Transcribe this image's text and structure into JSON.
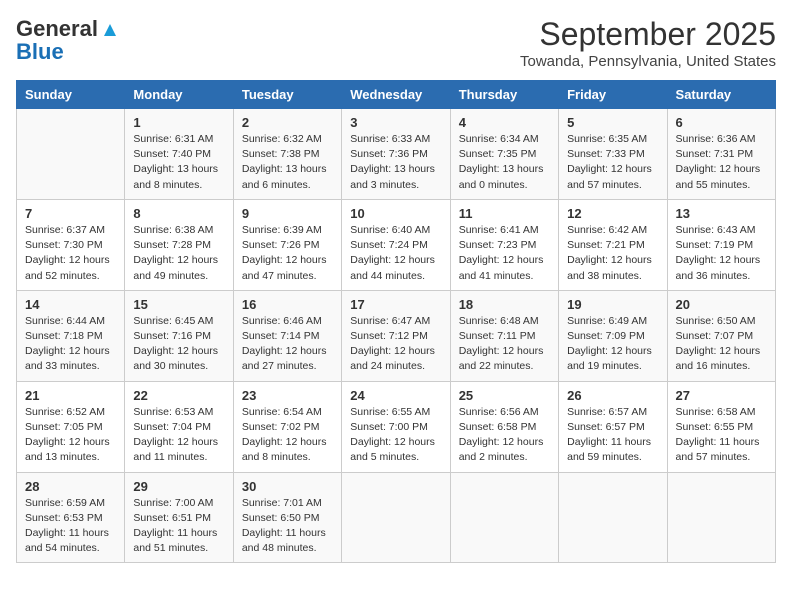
{
  "header": {
    "logo_general": "General",
    "logo_blue": "Blue",
    "month_title": "September 2025",
    "location": "Towanda, Pennsylvania, United States"
  },
  "days_of_week": [
    "Sunday",
    "Monday",
    "Tuesday",
    "Wednesday",
    "Thursday",
    "Friday",
    "Saturday"
  ],
  "weeks": [
    [
      {
        "day": "",
        "sunrise": "",
        "sunset": "",
        "daylight": ""
      },
      {
        "day": "1",
        "sunrise": "Sunrise: 6:31 AM",
        "sunset": "Sunset: 7:40 PM",
        "daylight": "Daylight: 13 hours and 8 minutes."
      },
      {
        "day": "2",
        "sunrise": "Sunrise: 6:32 AM",
        "sunset": "Sunset: 7:38 PM",
        "daylight": "Daylight: 13 hours and 6 minutes."
      },
      {
        "day": "3",
        "sunrise": "Sunrise: 6:33 AM",
        "sunset": "Sunset: 7:36 PM",
        "daylight": "Daylight: 13 hours and 3 minutes."
      },
      {
        "day": "4",
        "sunrise": "Sunrise: 6:34 AM",
        "sunset": "Sunset: 7:35 PM",
        "daylight": "Daylight: 13 hours and 0 minutes."
      },
      {
        "day": "5",
        "sunrise": "Sunrise: 6:35 AM",
        "sunset": "Sunset: 7:33 PM",
        "daylight": "Daylight: 12 hours and 57 minutes."
      },
      {
        "day": "6",
        "sunrise": "Sunrise: 6:36 AM",
        "sunset": "Sunset: 7:31 PM",
        "daylight": "Daylight: 12 hours and 55 minutes."
      }
    ],
    [
      {
        "day": "7",
        "sunrise": "Sunrise: 6:37 AM",
        "sunset": "Sunset: 7:30 PM",
        "daylight": "Daylight: 12 hours and 52 minutes."
      },
      {
        "day": "8",
        "sunrise": "Sunrise: 6:38 AM",
        "sunset": "Sunset: 7:28 PM",
        "daylight": "Daylight: 12 hours and 49 minutes."
      },
      {
        "day": "9",
        "sunrise": "Sunrise: 6:39 AM",
        "sunset": "Sunset: 7:26 PM",
        "daylight": "Daylight: 12 hours and 47 minutes."
      },
      {
        "day": "10",
        "sunrise": "Sunrise: 6:40 AM",
        "sunset": "Sunset: 7:24 PM",
        "daylight": "Daylight: 12 hours and 44 minutes."
      },
      {
        "day": "11",
        "sunrise": "Sunrise: 6:41 AM",
        "sunset": "Sunset: 7:23 PM",
        "daylight": "Daylight: 12 hours and 41 minutes."
      },
      {
        "day": "12",
        "sunrise": "Sunrise: 6:42 AM",
        "sunset": "Sunset: 7:21 PM",
        "daylight": "Daylight: 12 hours and 38 minutes."
      },
      {
        "day": "13",
        "sunrise": "Sunrise: 6:43 AM",
        "sunset": "Sunset: 7:19 PM",
        "daylight": "Daylight: 12 hours and 36 minutes."
      }
    ],
    [
      {
        "day": "14",
        "sunrise": "Sunrise: 6:44 AM",
        "sunset": "Sunset: 7:18 PM",
        "daylight": "Daylight: 12 hours and 33 minutes."
      },
      {
        "day": "15",
        "sunrise": "Sunrise: 6:45 AM",
        "sunset": "Sunset: 7:16 PM",
        "daylight": "Daylight: 12 hours and 30 minutes."
      },
      {
        "day": "16",
        "sunrise": "Sunrise: 6:46 AM",
        "sunset": "Sunset: 7:14 PM",
        "daylight": "Daylight: 12 hours and 27 minutes."
      },
      {
        "day": "17",
        "sunrise": "Sunrise: 6:47 AM",
        "sunset": "Sunset: 7:12 PM",
        "daylight": "Daylight: 12 hours and 24 minutes."
      },
      {
        "day": "18",
        "sunrise": "Sunrise: 6:48 AM",
        "sunset": "Sunset: 7:11 PM",
        "daylight": "Daylight: 12 hours and 22 minutes."
      },
      {
        "day": "19",
        "sunrise": "Sunrise: 6:49 AM",
        "sunset": "Sunset: 7:09 PM",
        "daylight": "Daylight: 12 hours and 19 minutes."
      },
      {
        "day": "20",
        "sunrise": "Sunrise: 6:50 AM",
        "sunset": "Sunset: 7:07 PM",
        "daylight": "Daylight: 12 hours and 16 minutes."
      }
    ],
    [
      {
        "day": "21",
        "sunrise": "Sunrise: 6:52 AM",
        "sunset": "Sunset: 7:05 PM",
        "daylight": "Daylight: 12 hours and 13 minutes."
      },
      {
        "day": "22",
        "sunrise": "Sunrise: 6:53 AM",
        "sunset": "Sunset: 7:04 PM",
        "daylight": "Daylight: 12 hours and 11 minutes."
      },
      {
        "day": "23",
        "sunrise": "Sunrise: 6:54 AM",
        "sunset": "Sunset: 7:02 PM",
        "daylight": "Daylight: 12 hours and 8 minutes."
      },
      {
        "day": "24",
        "sunrise": "Sunrise: 6:55 AM",
        "sunset": "Sunset: 7:00 PM",
        "daylight": "Daylight: 12 hours and 5 minutes."
      },
      {
        "day": "25",
        "sunrise": "Sunrise: 6:56 AM",
        "sunset": "Sunset: 6:58 PM",
        "daylight": "Daylight: 12 hours and 2 minutes."
      },
      {
        "day": "26",
        "sunrise": "Sunrise: 6:57 AM",
        "sunset": "Sunset: 6:57 PM",
        "daylight": "Daylight: 11 hours and 59 minutes."
      },
      {
        "day": "27",
        "sunrise": "Sunrise: 6:58 AM",
        "sunset": "Sunset: 6:55 PM",
        "daylight": "Daylight: 11 hours and 57 minutes."
      }
    ],
    [
      {
        "day": "28",
        "sunrise": "Sunrise: 6:59 AM",
        "sunset": "Sunset: 6:53 PM",
        "daylight": "Daylight: 11 hours and 54 minutes."
      },
      {
        "day": "29",
        "sunrise": "Sunrise: 7:00 AM",
        "sunset": "Sunset: 6:51 PM",
        "daylight": "Daylight: 11 hours and 51 minutes."
      },
      {
        "day": "30",
        "sunrise": "Sunrise: 7:01 AM",
        "sunset": "Sunset: 6:50 PM",
        "daylight": "Daylight: 11 hours and 48 minutes."
      },
      {
        "day": "",
        "sunrise": "",
        "sunset": "",
        "daylight": ""
      },
      {
        "day": "",
        "sunrise": "",
        "sunset": "",
        "daylight": ""
      },
      {
        "day": "",
        "sunrise": "",
        "sunset": "",
        "daylight": ""
      },
      {
        "day": "",
        "sunrise": "",
        "sunset": "",
        "daylight": ""
      }
    ]
  ]
}
